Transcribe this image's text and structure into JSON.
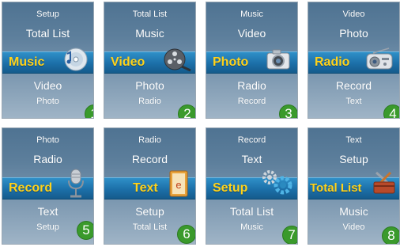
{
  "screens": [
    {
      "above_2": "Setup",
      "above_1": "Total List",
      "selected": "Music",
      "below_1": "Video",
      "below_2": "Photo",
      "step": "1",
      "icon": "music-cd-icon"
    },
    {
      "above_2": "Total List",
      "above_1": "Music",
      "selected": "Video",
      "below_1": "Photo",
      "below_2": "Radio",
      "step": "2",
      "icon": "film-reel-icon"
    },
    {
      "above_2": "Music",
      "above_1": "Video",
      "selected": "Photo",
      "below_1": "Radio",
      "below_2": "Record",
      "step": "3",
      "icon": "camera-icon"
    },
    {
      "above_2": "Video",
      "above_1": "Photo",
      "selected": "Radio",
      "below_1": "Record",
      "below_2": "Text",
      "step": "4",
      "icon": "radio-icon"
    },
    {
      "above_2": "Photo",
      "above_1": "Radio",
      "selected": "Record",
      "below_1": "Text",
      "below_2": "Setup",
      "step": "5",
      "icon": "microphone-icon"
    },
    {
      "above_2": "Radio",
      "above_1": "Record",
      "selected": "Text",
      "below_1": "Setup",
      "below_2": "Total List",
      "step": "6",
      "icon": "ebook-icon"
    },
    {
      "above_2": "Record",
      "above_1": "Text",
      "selected": "Setup",
      "below_1": "Total List",
      "below_2": "Music",
      "step": "7",
      "icon": "gears-icon"
    },
    {
      "above_2": "Text",
      "above_1": "Setup",
      "selected": "Total List",
      "below_1": "Music",
      "below_2": "Video",
      "step": "8",
      "icon": "toolbox-icon"
    }
  ],
  "colors": {
    "selected_text": "#ffd21a",
    "selection_band": "#1c6fa8",
    "step_badge": "#3a9a2c"
  }
}
